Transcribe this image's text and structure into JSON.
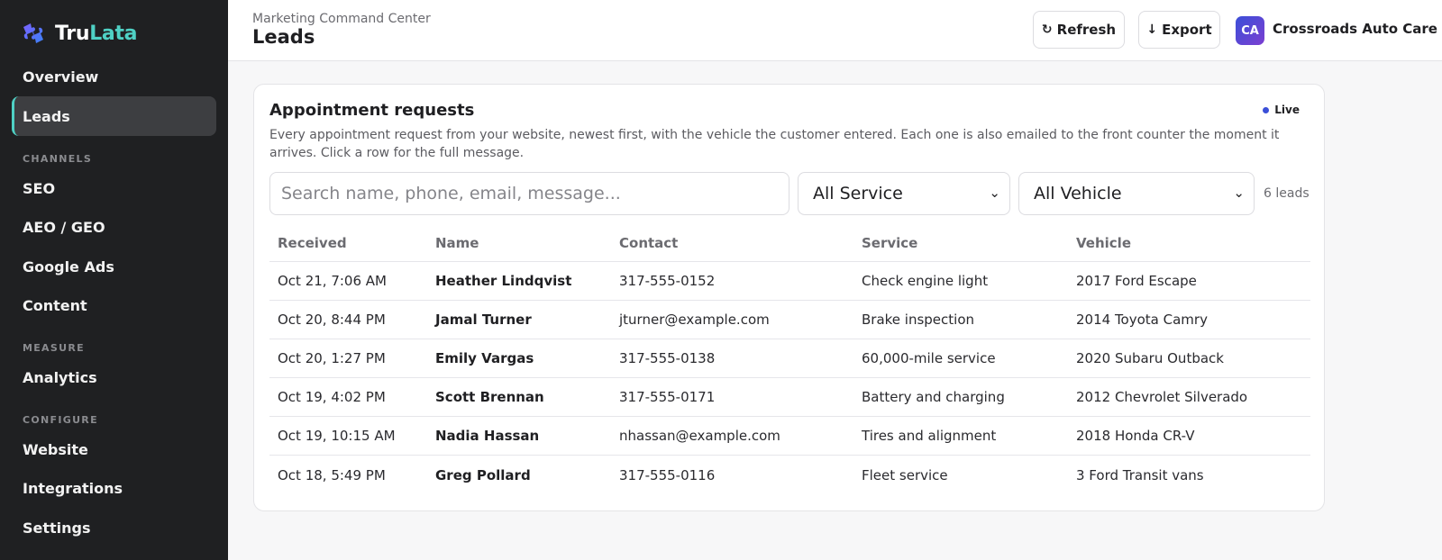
{
  "brand": {
    "name_part1": "Tru",
    "name_part2": "Lata",
    "logo_icon": "puzzle-logo-icon"
  },
  "sidebar": {
    "items": [
      {
        "label": "Overview"
      },
      {
        "label": "Leads",
        "active": true
      }
    ],
    "sections": [
      {
        "title": "CHANNELS",
        "items": [
          "SEO",
          "AEO / GEO",
          "Google Ads",
          "Content"
        ]
      },
      {
        "title": "MEASURE",
        "items": [
          "Analytics"
        ]
      },
      {
        "title": "CONFIGURE",
        "items": [
          "Website",
          "Integrations",
          "Settings"
        ]
      }
    ]
  },
  "header": {
    "subtitle": "Marketing Command Center",
    "title": "Leads",
    "refresh_label": "Refresh",
    "refresh_icon": "refresh-icon",
    "export_label": "Export",
    "export_icon": "arrow-down-icon",
    "avatar_initials": "CA",
    "org_name": "Crossroads Auto Care"
  },
  "card": {
    "title": "Appointment requests",
    "live_label": "Live",
    "description": "Every appointment request from your website, newest first, with the vehicle the customer entered. Each one is also emailed to the front counter the moment it arrives. Click a row for the full message.",
    "search_placeholder": "Search name, phone, email, message...",
    "service_filter": "All Service",
    "vehicle_filter": "All Vehicle",
    "lead_count": "6 leads"
  },
  "table": {
    "columns": [
      "Received",
      "Name",
      "Contact",
      "Service",
      "Vehicle"
    ],
    "rows": [
      [
        "Oct 21, 7:06 AM",
        "Heather Lindqvist",
        "317-555-0152",
        "Check engine light",
        "2017 Ford Escape"
      ],
      [
        "Oct 20, 8:44 PM",
        "Jamal Turner",
        "jturner@example.com",
        "Brake inspection",
        "2014 Toyota Camry"
      ],
      [
        "Oct 20, 1:27 PM",
        "Emily Vargas",
        "317-555-0138",
        "60,000-mile service",
        "2020 Subaru Outback"
      ],
      [
        "Oct 19, 4:02 PM",
        "Scott Brennan",
        "317-555-0171",
        "Battery and charging",
        "2012 Chevrolet Silverado"
      ],
      [
        "Oct 19, 10:15 AM",
        "Nadia Hassan",
        "nhassan@example.com",
        "Tires and alignment",
        "2018 Honda CR-V"
      ],
      [
        "Oct 18, 5:49 PM",
        "Greg Pollard",
        "317-555-0116",
        "Fleet service",
        "3 Ford Transit vans"
      ]
    ]
  },
  "colors": {
    "accent": "#4fd1c5",
    "sidebar_bg": "#1f2022",
    "live_dot": "#3b4fd8"
  }
}
